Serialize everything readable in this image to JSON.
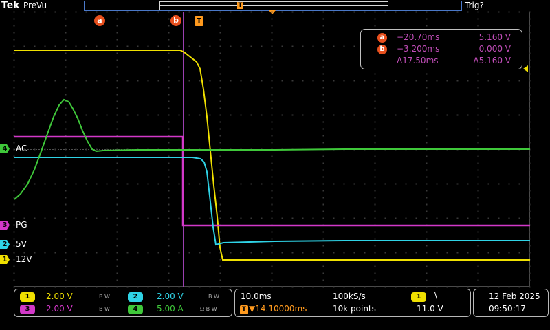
{
  "header": {
    "brand": "Tek",
    "mode": "PreVu",
    "trigger_status": "Trig?",
    "trigger_marker": "T"
  },
  "cursors": {
    "a": {
      "label": "a",
      "time": "−20.70ms",
      "value": "5.160 V"
    },
    "b": {
      "label": "b",
      "time": "−3.200ms",
      "value": "0.000 V"
    },
    "delta_time": "Δ17.50ms",
    "delta_value": "Δ5.160 V",
    "trigger_label": "T"
  },
  "channels": {
    "ac": {
      "number": "4",
      "label": "AC",
      "color": "#3fc83a"
    },
    "pg": {
      "number": "3",
      "label": "PG",
      "color": "#d238c8"
    },
    "v5": {
      "number": "2",
      "label": "5V",
      "color": "#2fd3e6"
    },
    "v12": {
      "number": "1",
      "label": "12V",
      "color": "#f0e000"
    }
  },
  "settings": {
    "ch1": {
      "number": "1",
      "scale": "2.00 V",
      "bw": "B W"
    },
    "ch2": {
      "number": "2",
      "scale": "2.00 V",
      "bw": "B W"
    },
    "ch3": {
      "number": "3",
      "scale": "2.00 V",
      "bw": "B W"
    },
    "ch4": {
      "number": "4",
      "scale": "5.00 A",
      "bw": "Ω B W"
    },
    "timebase": "10.0ms",
    "sample_rate": "100kS/s",
    "trigger_position": "▼14.10000ms",
    "record_length": "10k points",
    "trigger_source": "1",
    "trigger_slope": "\\",
    "trigger_level": "11.0 V",
    "date": "12 Feb  2025",
    "time": "09:50:17"
  }
}
